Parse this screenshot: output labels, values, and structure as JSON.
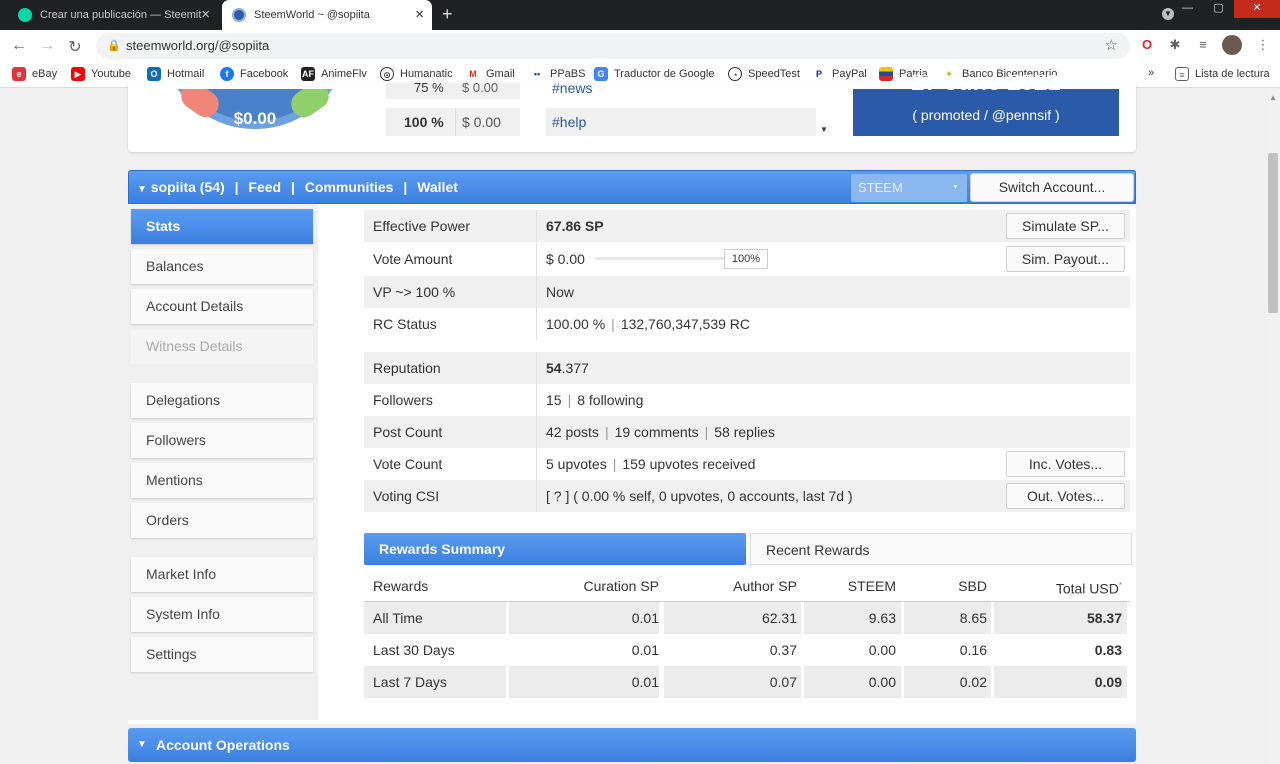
{
  "browser": {
    "tabs": [
      {
        "title": "Crear una publicación — Steemit"
      },
      {
        "title": "SteemWorld ~ @sopiita"
      }
    ],
    "url": "steemworld.org/@sopiita",
    "bookmarks": [
      "eBay",
      "Youtube",
      "Hotmail",
      "Facebook",
      "AnimeFlv",
      "Humanatic",
      "Gmail",
      "PPaBS",
      "Traductor de Google",
      "SpeedTest",
      "PayPal",
      "Patria",
      "Banco Bicentenario"
    ],
    "reading_list": "Lista de lectura",
    "bookmark_more": "»"
  },
  "top": {
    "gauge_value": "$0.00",
    "vote_table": [
      {
        "pct": "75 %",
        "value": "$ 0.00"
      },
      {
        "pct": "100 %",
        "value": "$ 0.00"
      }
    ],
    "tags": [
      "#news",
      "#help"
    ],
    "promo_date": "27 June 2021",
    "promo_text": "( promoted / @pennsif )"
  },
  "header": {
    "account": "sopiita (54)",
    "links": [
      "Feed",
      "Communities",
      "Wallet"
    ],
    "currency": "STEEM",
    "switch_label": "Switch Account..."
  },
  "sidebar": {
    "items": [
      {
        "label": "Stats"
      },
      {
        "label": "Balances"
      },
      {
        "label": "Account Details"
      },
      {
        "label": "Witness Details"
      },
      {
        "label": "Delegations"
      },
      {
        "label": "Followers"
      },
      {
        "label": "Mentions"
      },
      {
        "label": "Orders"
      },
      {
        "label": "Market Info"
      },
      {
        "label": "System Info"
      },
      {
        "label": "Settings"
      }
    ]
  },
  "stats": {
    "effective_power": {
      "label": "Effective Power",
      "value": "67.86 SP",
      "button": "Simulate SP..."
    },
    "vote_amount": {
      "label": "Vote Amount",
      "value": "$ 0.00",
      "slider_pct": "100%",
      "slider_level": 1.0,
      "button": "Sim. Payout..."
    },
    "vp": {
      "label": "VP ~> 100 %",
      "value": "Now"
    },
    "rc": {
      "label": "RC Status",
      "pct": "100.00 %",
      "amount": "132,760,347,539 RC"
    },
    "reputation": {
      "label": "Reputation",
      "value_main": "54",
      "value_dec": ".377"
    },
    "followers": {
      "label": "Followers",
      "followers": "15",
      "following": "8 following"
    },
    "post_count": {
      "label": "Post Count",
      "posts": "42 posts",
      "comments": "19 comments",
      "replies": "58 replies"
    },
    "vote_count": {
      "label": "Vote Count",
      "upvotes": "5 upvotes",
      "received": "159 upvotes received",
      "button": "Inc. Votes..."
    },
    "voting_csi": {
      "label": "Voting CSI",
      "value": "[ ? ] ( 0.00 % self, 0 upvotes, 0 accounts, last 7d )",
      "button": "Out. Votes..."
    }
  },
  "rewards": {
    "tabs": [
      "Rewards Summary",
      "Recent Rewards"
    ],
    "headers": [
      "Rewards",
      "Curation SP",
      "Author SP",
      "STEEM",
      "SBD",
      "Total USD"
    ],
    "total_marker": "*",
    "rows": [
      {
        "period": "All Time",
        "curation": "0.01",
        "author": "62.31",
        "steem": "9.63",
        "sbd": "8.65",
        "total": "58.37"
      },
      {
        "period": "Last 30 Days",
        "curation": "0.01",
        "author": "0.37",
        "steem": "0.00",
        "sbd": "0.16",
        "total": "0.83"
      },
      {
        "period": "Last 7 Days",
        "curation": "0.01",
        "author": "0.07",
        "steem": "0.00",
        "sbd": "0.02",
        "total": "0.09"
      }
    ]
  },
  "account_operations": "Account Operations",
  "colors": {
    "accent": "#3c7fe0",
    "header_blue": "#5a9cf0",
    "promo_blue": "#2a5aa8"
  }
}
